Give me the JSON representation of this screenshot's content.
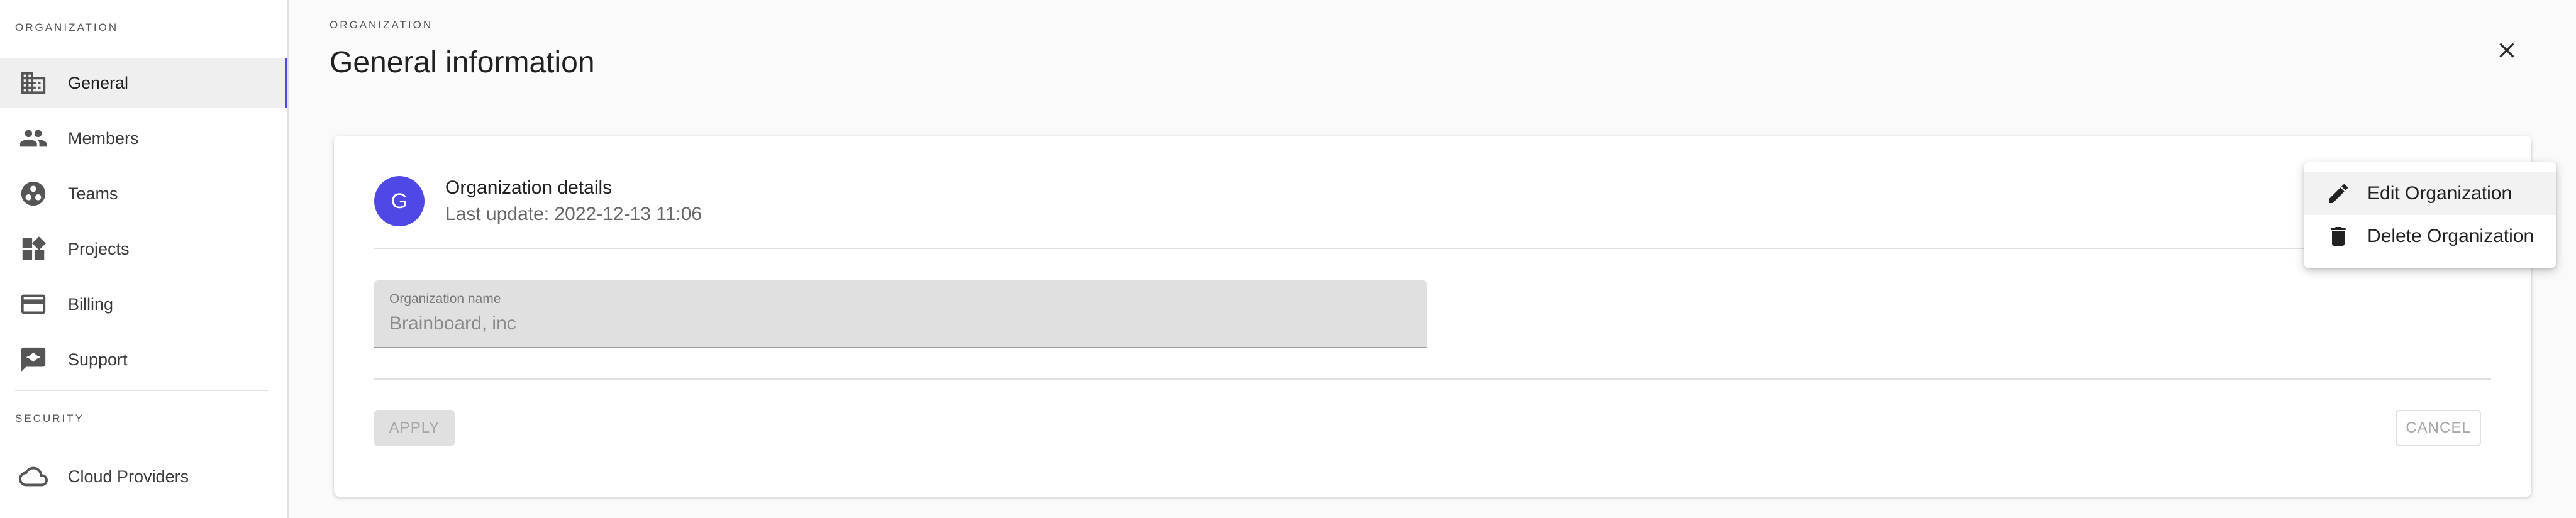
{
  "sidebar": {
    "organization_header": "ORGANIZATION",
    "security_header": "SECURITY",
    "items": [
      {
        "label": "General",
        "icon": "building-icon",
        "active": true
      },
      {
        "label": "Members",
        "icon": "people-icon"
      },
      {
        "label": "Teams",
        "icon": "teams-icon"
      },
      {
        "label": "Projects",
        "icon": "projects-icon"
      },
      {
        "label": "Billing",
        "icon": "credit-card-icon"
      },
      {
        "label": "Support",
        "icon": "support-icon"
      }
    ],
    "security_items": [
      {
        "label": "Cloud Providers",
        "icon": "cloud-icon"
      }
    ],
    "accent_color": "#5048e5"
  },
  "header": {
    "breadcrumb": "ORGANIZATION",
    "title": "General information"
  },
  "card": {
    "avatar_letter": "G",
    "title": "Organization details",
    "subtitle": "Last update: 2022-12-13 11:06",
    "field": {
      "label": "Organization name",
      "value": "Brainboard, inc"
    },
    "apply_label": "APPLY",
    "cancel_label": "CANCEL"
  },
  "menu": {
    "items": [
      {
        "label": "Edit Organization",
        "icon": "pencil-icon"
      },
      {
        "label": "Delete Organization",
        "icon": "trash-icon"
      }
    ]
  }
}
